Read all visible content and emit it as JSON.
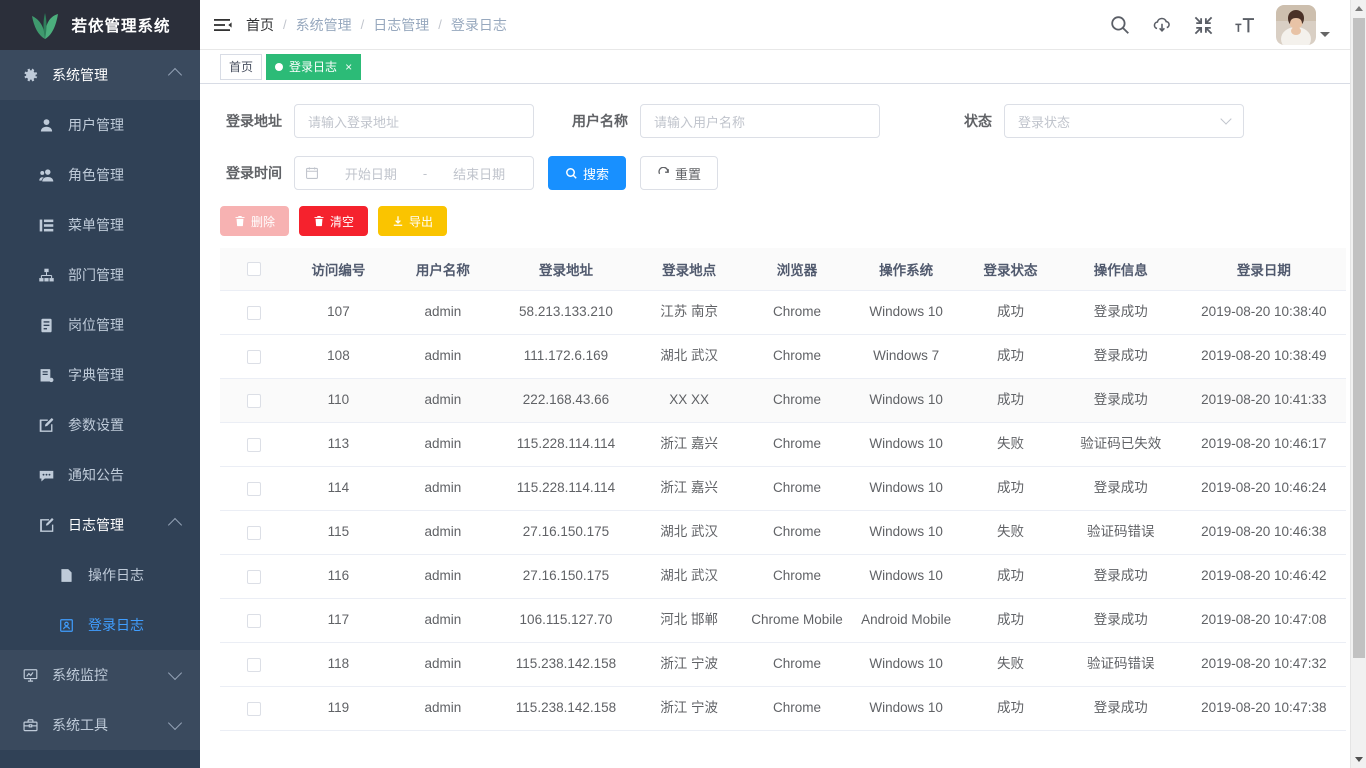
{
  "app": {
    "logo_text": "若依管理系统",
    "accent_blue": "#409eff",
    "tag_green": "#2cbb77",
    "sidebar_bg": "#304156"
  },
  "sidebar": {
    "group": {
      "label": "系统管理",
      "icon": "gear-icon"
    },
    "items": [
      {
        "label": "用户管理",
        "icon": "user-icon"
      },
      {
        "label": "角色管理",
        "icon": "role-icon"
      },
      {
        "label": "菜单管理",
        "icon": "menu-list-icon"
      },
      {
        "label": "部门管理",
        "icon": "sitemap-icon"
      },
      {
        "label": "岗位管理",
        "icon": "post-icon"
      },
      {
        "label": "字典管理",
        "icon": "book-icon"
      },
      {
        "label": "参数设置",
        "icon": "edit-icon"
      },
      {
        "label": "通知公告",
        "icon": "comment-icon"
      }
    ],
    "log_group": {
      "label": "日志管理",
      "icon": "log-edit-icon"
    },
    "log_items": [
      {
        "label": "操作日志",
        "icon": "document-icon",
        "active": false
      },
      {
        "label": "登录日志",
        "icon": "login-log-icon",
        "active": true
      }
    ],
    "bottom_groups": [
      {
        "label": "系统监控",
        "icon": "monitor-icon"
      },
      {
        "label": "系统工具",
        "icon": "toolbox-icon"
      }
    ]
  },
  "navbar": {
    "hamburger_icon": "hamburger-icon",
    "breadcrumb": [
      "首页",
      "系统管理",
      "日志管理",
      "登录日志"
    ],
    "separator": "/",
    "right_icons": [
      "search-icon",
      "cloud-download-icon",
      "exit-fullscreen-icon",
      "font-size-icon"
    ],
    "avatar_caret": "chevron-down-icon"
  },
  "tags": [
    {
      "label": "首页",
      "active": false,
      "closable": false
    },
    {
      "label": "登录日志",
      "active": true,
      "closable": true,
      "close_label": "×"
    }
  ],
  "filters": {
    "login_address": {
      "label": "登录地址",
      "placeholder": "请输入登录地址",
      "value": ""
    },
    "user_name": {
      "label": "用户名称",
      "placeholder": "请输入用户名称",
      "value": ""
    },
    "status": {
      "label": "状态",
      "placeholder": "登录状态",
      "value": ""
    },
    "login_time": {
      "label": "登录时间",
      "start_placeholder": "开始日期",
      "end_placeholder": "结束日期",
      "separator": "-",
      "calendar_icon": "calendar-icon"
    },
    "search_button": {
      "label": "搜索",
      "icon": "search-icon"
    },
    "reset_button": {
      "label": "重置",
      "icon": "refresh-icon"
    }
  },
  "toolbar": [
    {
      "label": "删除",
      "icon": "trash-icon",
      "style": "danger-light"
    },
    {
      "label": "清空",
      "icon": "trash-icon",
      "style": "danger"
    },
    {
      "label": "导出",
      "icon": "download-icon",
      "style": "warning"
    }
  ],
  "table": {
    "select_all_checkbox": true,
    "columns": [
      "",
      "访问编号",
      "用户名称",
      "登录地址",
      "登录地点",
      "浏览器",
      "操作系统",
      "登录状态",
      "操作信息",
      "登录日期"
    ],
    "rows": [
      {
        "id": "107",
        "user": "admin",
        "ip": "58.213.133.210",
        "location": "江苏 南京",
        "browser": "Chrome",
        "os": "Windows 10",
        "status": "成功",
        "message": "登录成功",
        "date": "2019-08-20 10:38:40",
        "highlight": false
      },
      {
        "id": "108",
        "user": "admin",
        "ip": "111.172.6.169",
        "location": "湖北 武汉",
        "browser": "Chrome",
        "os": "Windows 7",
        "status": "成功",
        "message": "登录成功",
        "date": "2019-08-20 10:38:49",
        "highlight": false
      },
      {
        "id": "110",
        "user": "admin",
        "ip": "222.168.43.66",
        "location": "XX XX",
        "browser": "Chrome",
        "os": "Windows 10",
        "status": "成功",
        "message": "登录成功",
        "date": "2019-08-20 10:41:33",
        "highlight": true
      },
      {
        "id": "113",
        "user": "admin",
        "ip": "115.228.114.114",
        "location": "浙江 嘉兴",
        "browser": "Chrome",
        "os": "Windows 10",
        "status": "失败",
        "message": "验证码已失效",
        "date": "2019-08-20 10:46:17",
        "highlight": false
      },
      {
        "id": "114",
        "user": "admin",
        "ip": "115.228.114.114",
        "location": "浙江 嘉兴",
        "browser": "Chrome",
        "os": "Windows 10",
        "status": "成功",
        "message": "登录成功",
        "date": "2019-08-20 10:46:24",
        "highlight": false
      },
      {
        "id": "115",
        "user": "admin",
        "ip": "27.16.150.175",
        "location": "湖北 武汉",
        "browser": "Chrome",
        "os": "Windows 10",
        "status": "失败",
        "message": "验证码错误",
        "date": "2019-08-20 10:46:38",
        "highlight": false
      },
      {
        "id": "116",
        "user": "admin",
        "ip": "27.16.150.175",
        "location": "湖北 武汉",
        "browser": "Chrome",
        "os": "Windows 10",
        "status": "成功",
        "message": "登录成功",
        "date": "2019-08-20 10:46:42",
        "highlight": false
      },
      {
        "id": "117",
        "user": "admin",
        "ip": "106.115.127.70",
        "location": "河北 邯郸",
        "browser": "Chrome Mobile",
        "os": "Android Mobile",
        "status": "成功",
        "message": "登录成功",
        "date": "2019-08-20 10:47:08",
        "highlight": false
      },
      {
        "id": "118",
        "user": "admin",
        "ip": "115.238.142.158",
        "location": "浙江 宁波",
        "browser": "Chrome",
        "os": "Windows 10",
        "status": "失败",
        "message": "验证码错误",
        "date": "2019-08-20 10:47:32",
        "highlight": false
      },
      {
        "id": "119",
        "user": "admin",
        "ip": "115.238.142.158",
        "location": "浙江 宁波",
        "browser": "Chrome",
        "os": "Windows 10",
        "status": "成功",
        "message": "登录成功",
        "date": "2019-08-20 10:47:38",
        "highlight": false
      }
    ]
  }
}
